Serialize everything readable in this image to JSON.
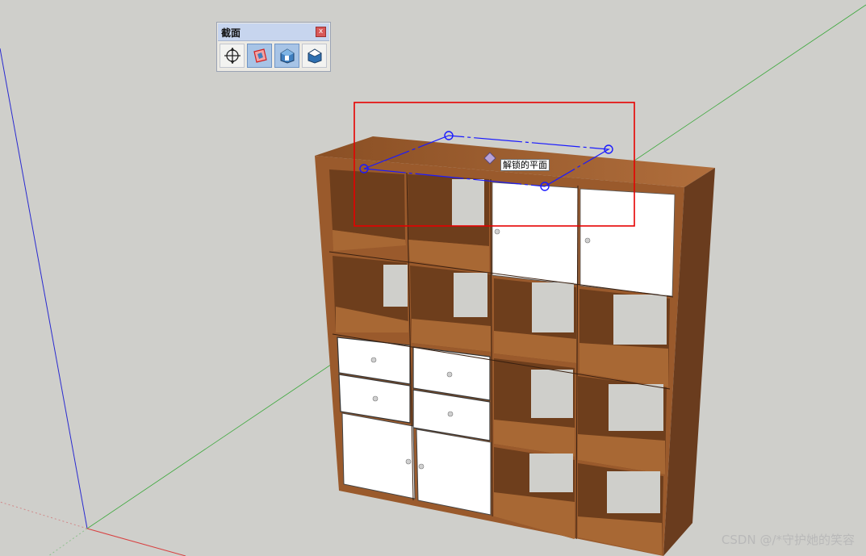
{
  "toolbar": {
    "title": "截面",
    "close_glyph": "x",
    "buttons": [
      {
        "icon": "add-section-plane-icon",
        "active": false
      },
      {
        "icon": "display-section-planes-icon",
        "active": true
      },
      {
        "icon": "display-section-cuts-icon",
        "active": true
      },
      {
        "icon": "section-fill-icon",
        "active": false
      }
    ]
  },
  "tooltip": {
    "text": "解锁的平面"
  },
  "watermark": {
    "text": "CSDN @/*守护她的笑容"
  },
  "colors": {
    "background": "#cfcfcb",
    "wood_frame": "#9a5a2c",
    "wood_dark": "#6a3c1e",
    "door_white": "#ffffff",
    "section_plane": "#1a1aff",
    "highlight_box": "#e60000",
    "axis_red": "#d84040",
    "axis_green": "#3aa83a",
    "axis_blue": "#2a2ad0"
  }
}
